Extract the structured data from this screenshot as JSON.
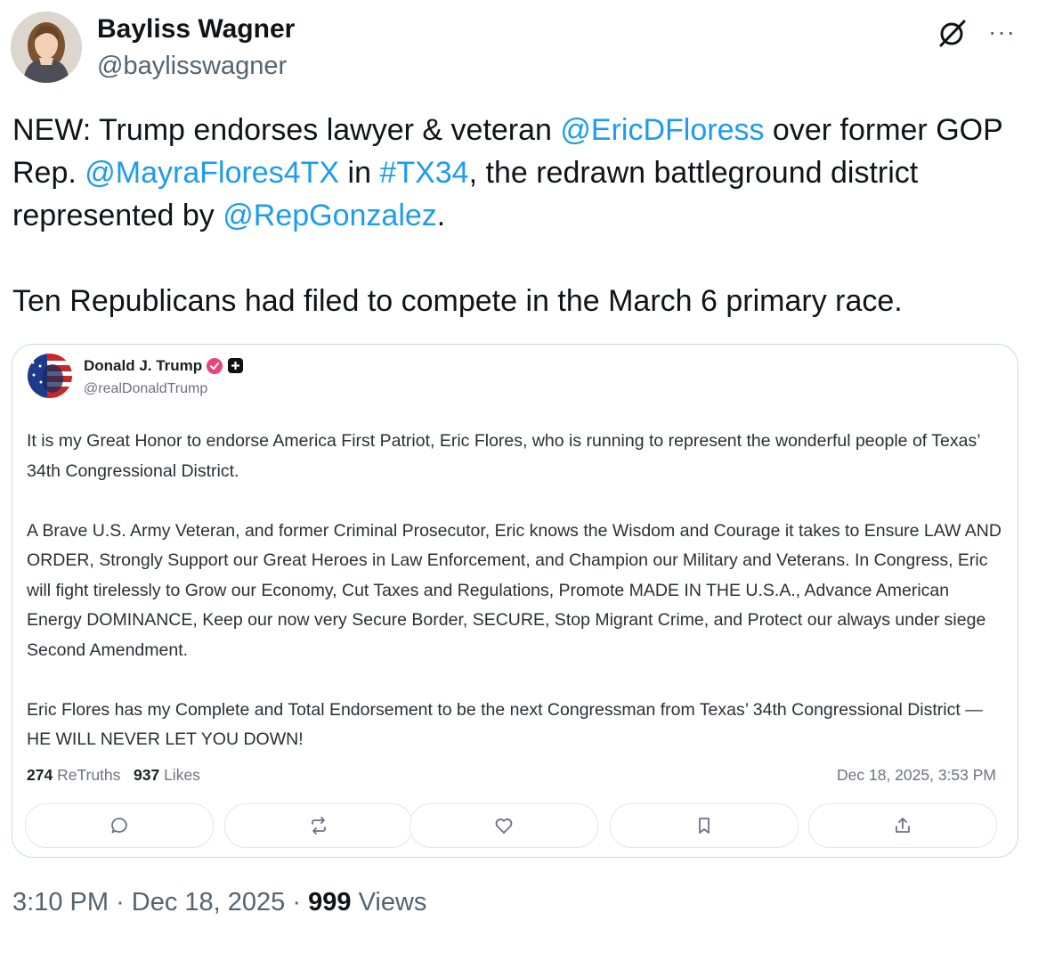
{
  "author": {
    "name": "Bayliss Wagner",
    "handle": "@baylisswagner",
    "avatar_icon": "profile-photo"
  },
  "header_icons": {
    "grok": "grok-slash-icon",
    "more": "···"
  },
  "tweet": {
    "line1_pre": "NEW: Trump endorses lawyer & veteran ",
    "mention1": "@EricDFloress",
    "line1_mid": " over former GOP Rep. ",
    "mention2": "@MayraFlores4TX",
    "line1_in": " in ",
    "hashtag": "#TX34",
    "line1_post": ", the redrawn battleground district represented by ",
    "mention3": "@RepGonzalez",
    "line1_end": ".",
    "paragraph2": "Ten Republicans had filed to compete in the March 6 primary race."
  },
  "quote": {
    "name": "Donald J. Trump",
    "handle": "@realDonaldTrump",
    "paragraphs": [
      "It is my Great Honor to endorse America First Patriot, Eric Flores, who is running to represent the wonderful people of Texas’ 34th Congressional District.",
      "A Brave U.S. Army Veteran, and former Criminal Prosecutor, Eric knows the Wisdom and Courage it takes to Ensure LAW AND ORDER, Strongly Support our Great Heroes in Law Enforcement, and Champion our Military and Veterans. In Congress, Eric will fight tirelessly to Grow our Economy, Cut Taxes and Regulations, Promote MADE IN THE U.S.A., Advance American Energy DOMINANCE, Keep our now very Secure Border, SECURE, Stop Migrant Crime, and Protect our always under siege Second Amendment.",
      "Eric Flores has my Complete and Total Endorsement to be the next Congressman from Texas’ 34th Congressional District — HE WILL NEVER LET YOU DOWN!"
    ],
    "retruths_count": "274",
    "retruths_label": "ReTruths",
    "likes_count": "937",
    "likes_label": "Likes",
    "date": "Dec 18, 2025, 3:53 PM",
    "actions": [
      "reply-icon",
      "retruth-icon",
      "like-icon",
      "bookmark-icon",
      "share-icon"
    ]
  },
  "footer": {
    "time": "3:10 PM",
    "sep": "·",
    "date": "Dec 18, 2025",
    "views_count": "999",
    "views_label": "Views"
  },
  "colors": {
    "link": "#1d9bf0",
    "text": "#0f1419",
    "muted": "#536471",
    "verified": "#e8457c"
  }
}
